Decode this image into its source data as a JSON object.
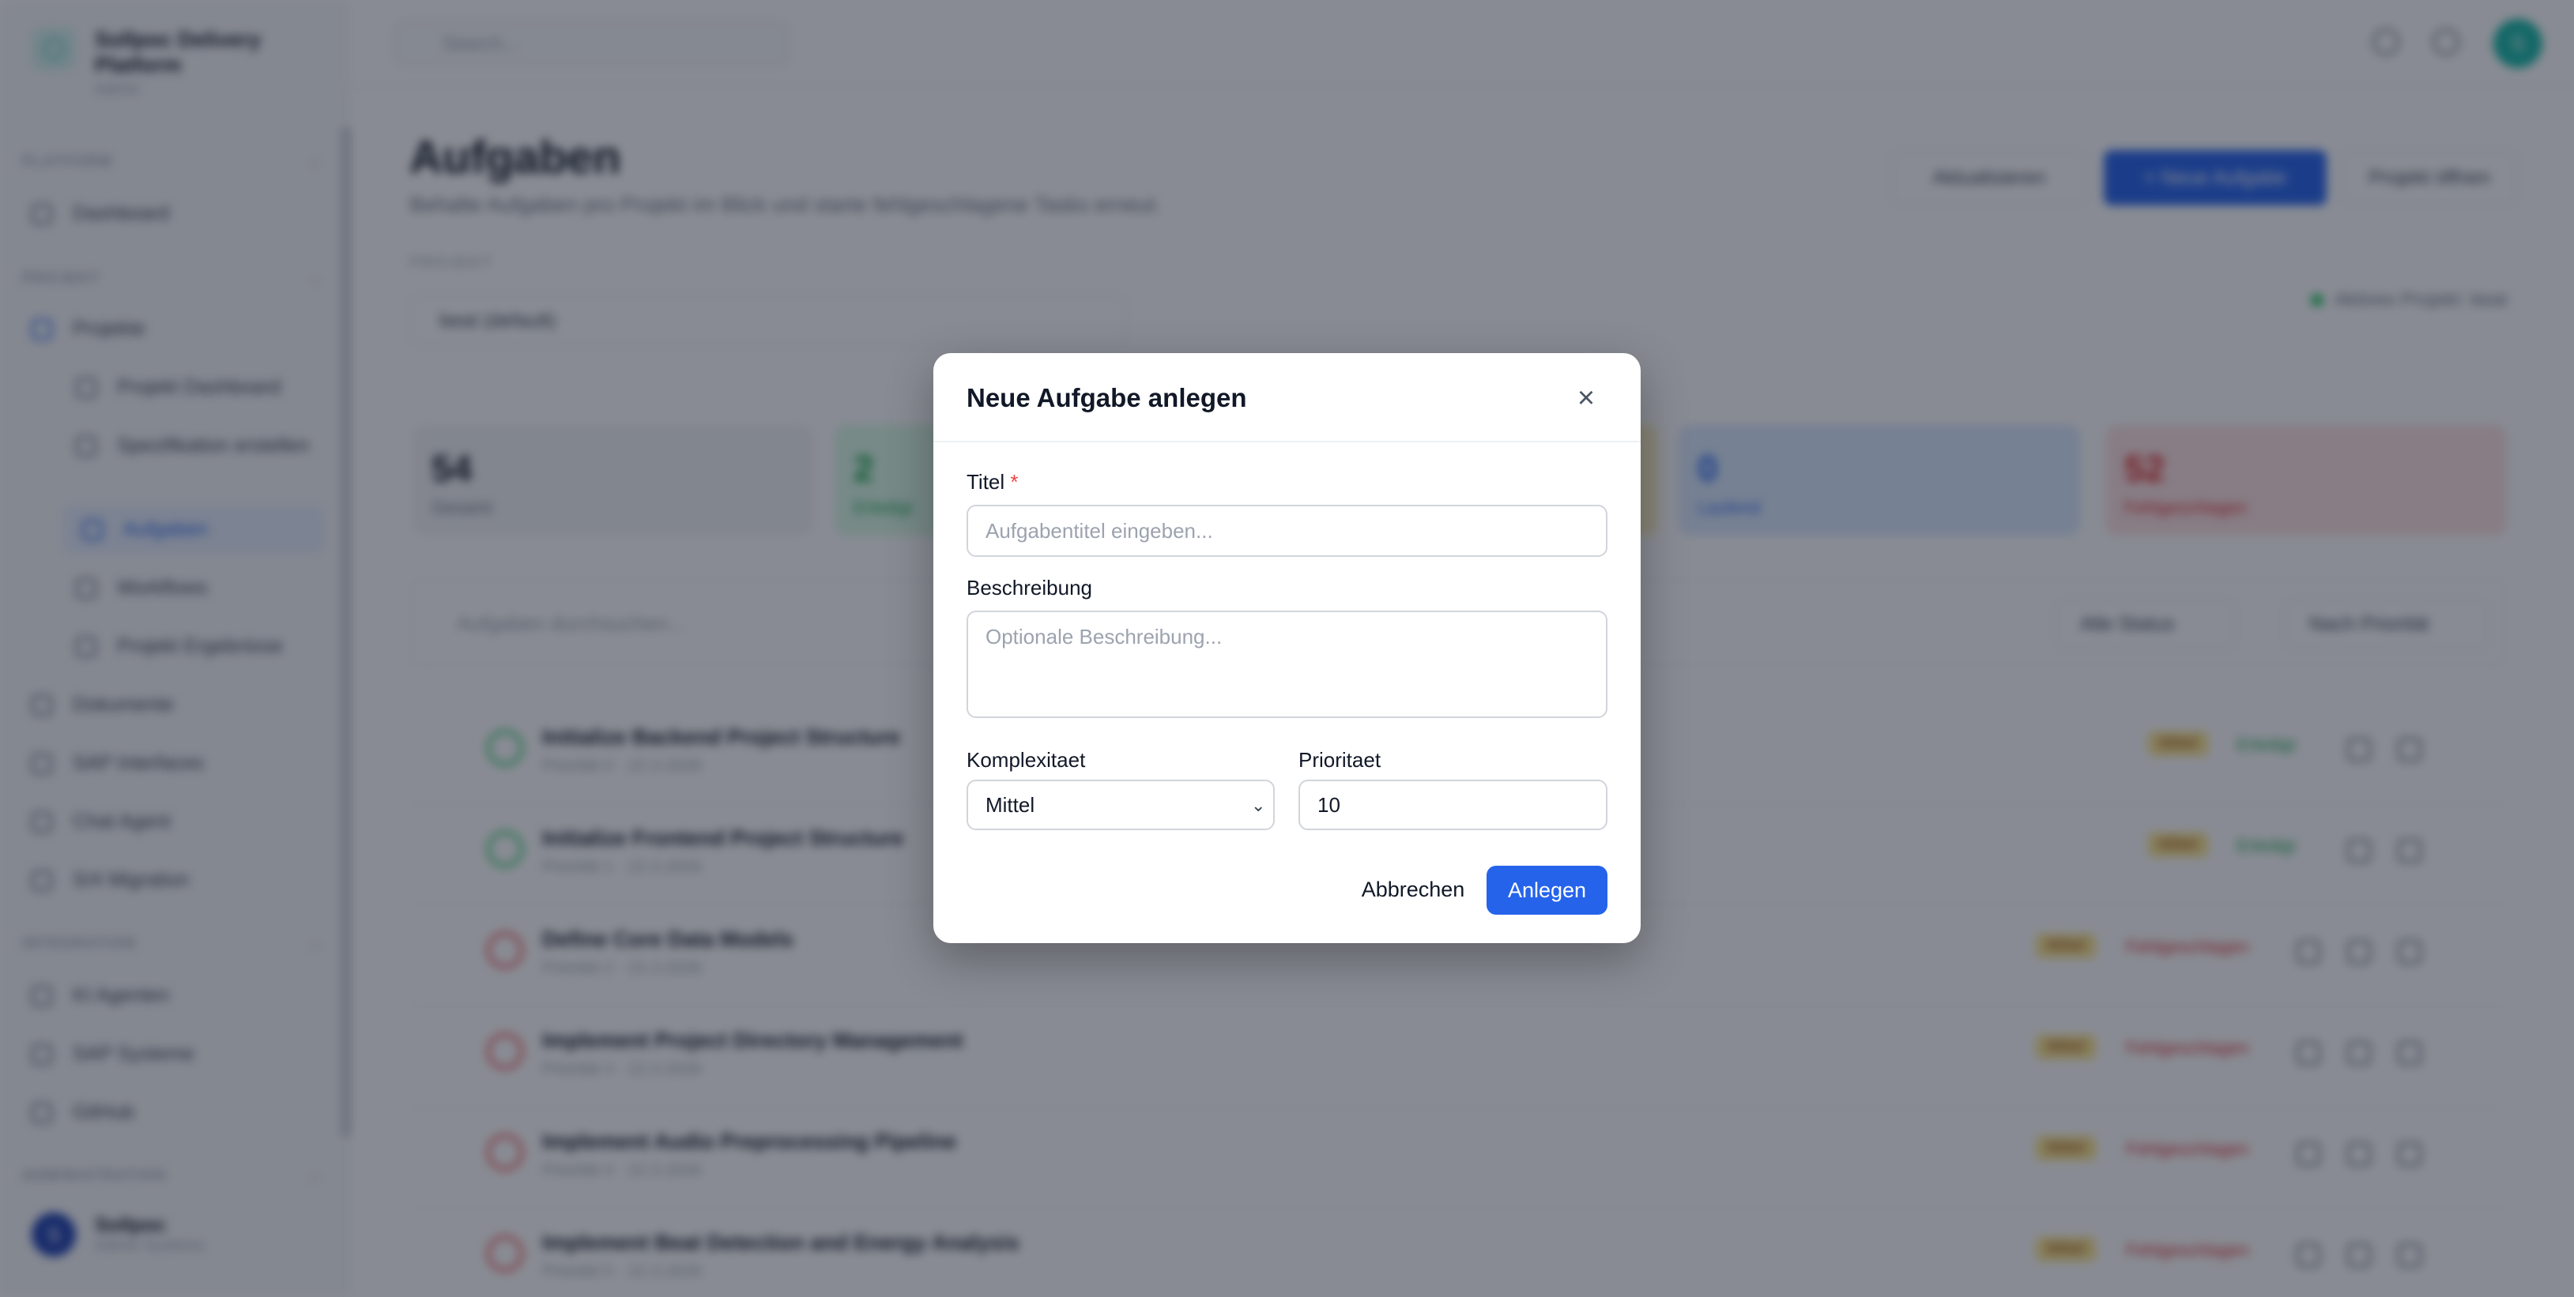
{
  "brand": {
    "title": "Sollpoc Delivery Platform",
    "subtitle": "Admin"
  },
  "sidebar": {
    "sections": [
      {
        "label": "PLATFORM"
      },
      {
        "label": "PROJEKT"
      },
      {
        "label": "INTEGRATION"
      },
      {
        "label": "ADMINISTRATION"
      }
    ],
    "items": [
      {
        "label": "Dashboard"
      },
      {
        "label": "Projekte"
      },
      {
        "label": "Projekt Dashboard"
      },
      {
        "label": "Spezifikation erstellen"
      },
      {
        "label": "Aufgaben"
      },
      {
        "label": "Workflows"
      },
      {
        "label": "Projekt Ergebnisse"
      },
      {
        "label": "Dokumente"
      },
      {
        "label": "SAP Interfaces"
      },
      {
        "label": "Chat Agent"
      },
      {
        "label": "S/4 Migration"
      },
      {
        "label": "KI Agenten"
      },
      {
        "label": "SAP Systeme"
      },
      {
        "label": "GitHub"
      }
    ],
    "user": {
      "initial": "S",
      "name": "Sollpoc",
      "role": "Admin Systems"
    }
  },
  "topbar": {
    "search_placeholder": "Search...",
    "avatar_initial": "S"
  },
  "page": {
    "title": "Aufgaben",
    "subtitle": "Behalte Aufgaben pro Projekt im Blick und starte fehlgeschlagene Tasks erneut.",
    "refresh_label": "Aktualisieren",
    "new_task_label": "+ Neue Aufgabe",
    "open_project_label": "Projekt öffnen",
    "project_label": "PROJEKT",
    "project_value": "beat (default)",
    "project_status": "Aktives Projekt: beat"
  },
  "stats": [
    {
      "value": "54",
      "label": "Gesamt"
    },
    {
      "value": "2",
      "label": "Erledigt"
    },
    {
      "value": "0",
      "label": "Laufend"
    },
    {
      "value": "52",
      "label": "Fehlgeschlagen"
    }
  ],
  "filters": {
    "search_placeholder": "Aufgaben durchsuchen...",
    "status": "Alle Status",
    "sort": "Nach Priorität"
  },
  "tasks": [
    {
      "title": "Initialize Backend Project Structure",
      "meta": "Priorität 0 · 22.3.2026",
      "complexity": "Mittel",
      "status": "Erledigt"
    },
    {
      "title": "Initialize Frontend Project Structure",
      "meta": "Priorität 1 · 22.3.2026",
      "complexity": "Mittel",
      "status": "Erledigt"
    },
    {
      "title": "Define Core Data Models",
      "meta": "Priorität 2 · 22.3.2026",
      "complexity": "Mittel",
      "status": "Fehlgeschlagen"
    },
    {
      "title": "Implement Project Directory Management",
      "meta": "Priorität 3 · 22.3.2026",
      "complexity": "Mittel",
      "status": "Fehlgeschlagen"
    },
    {
      "title": "Implement Audio Preprocessing Pipeline",
      "meta": "Priorität 4 · 22.3.2026",
      "complexity": "Mittel",
      "status": "Fehlgeschlagen"
    },
    {
      "title": "Implement Beat Detection and Energy Analysis",
      "meta": "Priorität 5 · 22.3.2026",
      "complexity": "Mittel",
      "status": "Fehlgeschlagen"
    }
  ],
  "modal": {
    "title": "Neue Aufgabe anlegen",
    "close_icon": "×",
    "title_label": "Titel",
    "required_mark": "*",
    "title_placeholder": "Aufgabentitel eingeben...",
    "description_label": "Beschreibung",
    "description_placeholder": "Optionale Beschreibung...",
    "complexity_label": "Komplexitaet",
    "complexity_value": "Mittel",
    "priority_label": "Prioritaet",
    "priority_value": "10",
    "cancel_label": "Abbrechen",
    "submit_label": "Anlegen"
  },
  "colors": {
    "primary": "#2563eb",
    "success": "#22c55e",
    "danger": "#ef4444",
    "warning": "#fde68a",
    "accent": "#14b8a6"
  }
}
